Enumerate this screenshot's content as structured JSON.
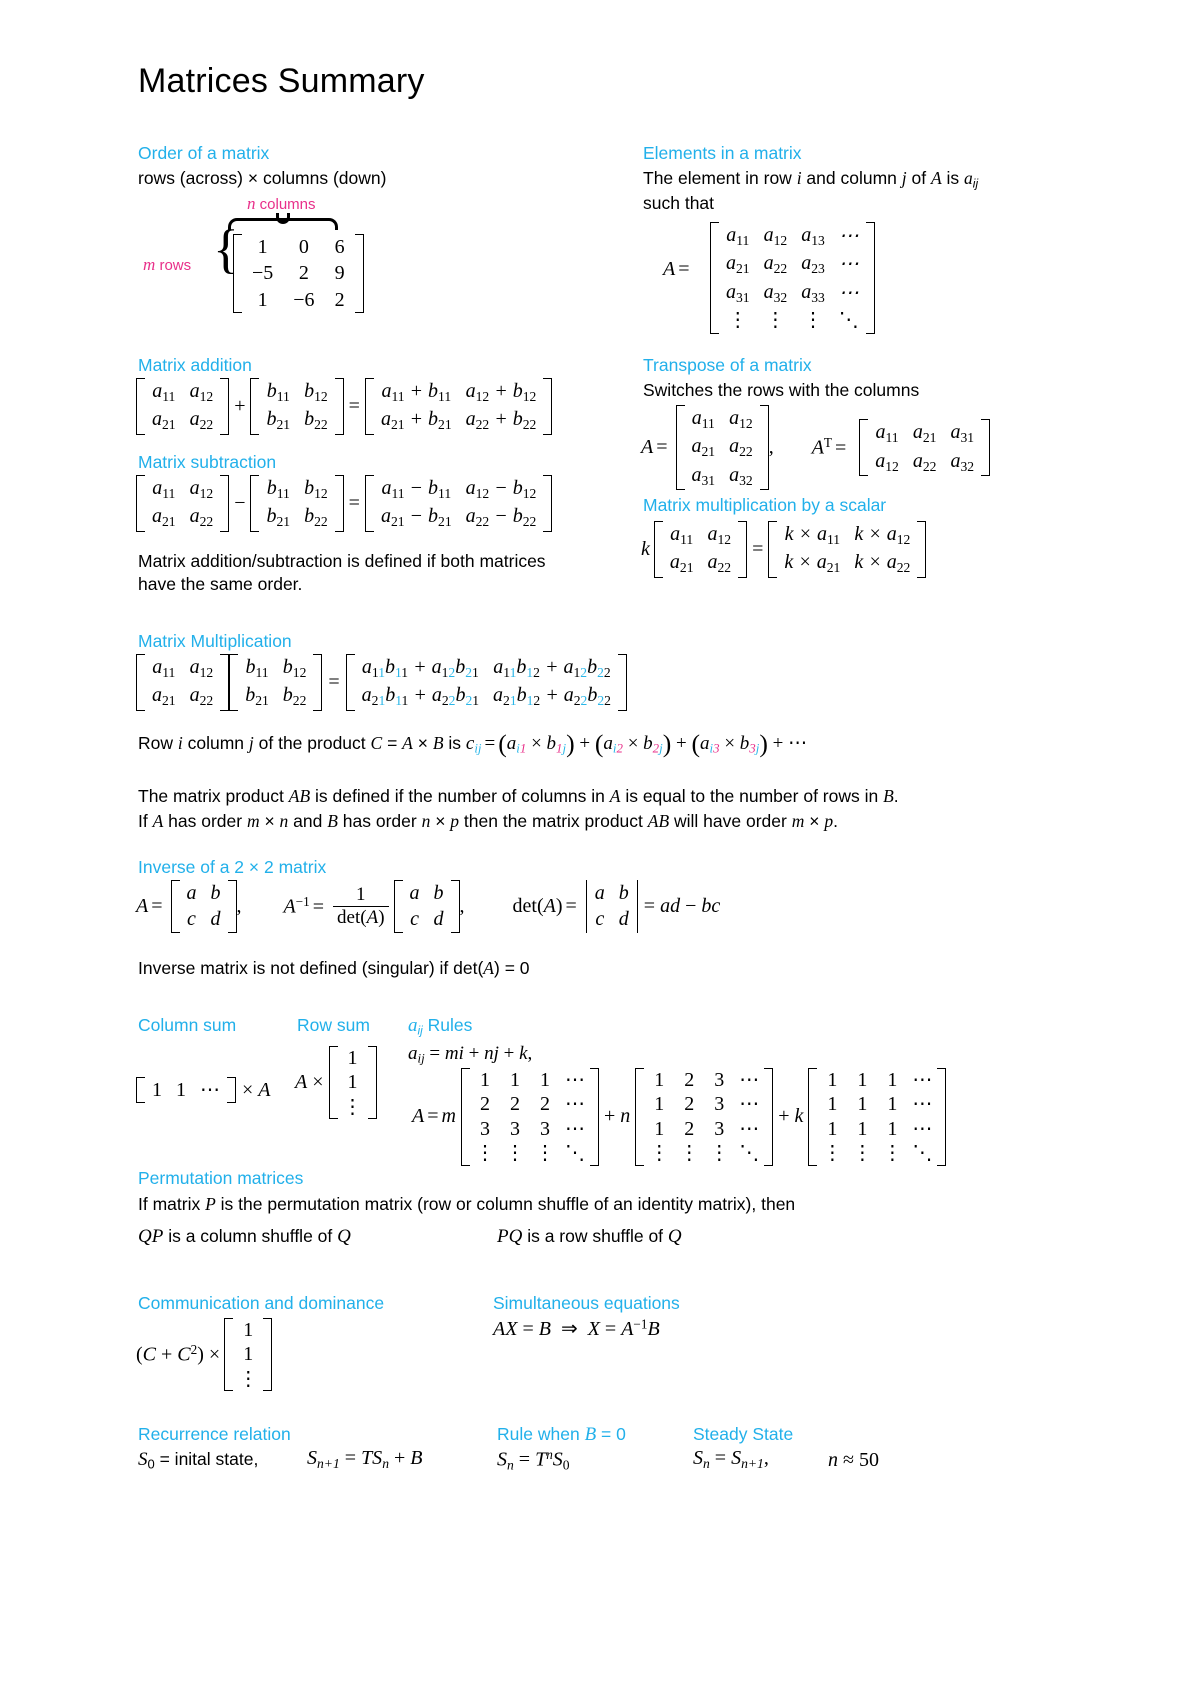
{
  "document": {
    "title": "Matrices Summary"
  },
  "colors": {
    "heading": "#22b0ea",
    "accent_cyan": "#29b6e8",
    "accent_magenta": "#e8308a",
    "text": "#000000",
    "background": "#ffffff"
  },
  "sections": {
    "order": {
      "heading": "Order of a matrix",
      "body": "rows (across) × columns (down)",
      "label_columns": "n columns",
      "label_rows": "m rows",
      "matrix": [
        [
          "1",
          "0",
          "6"
        ],
        [
          "−5",
          "2",
          "9"
        ],
        [
          "1",
          "−6",
          "2"
        ]
      ]
    },
    "elements": {
      "heading": "Elements in a matrix",
      "body_line1": "The element in row i and column j of A is a",
      "body_line1_sub": "ij",
      "body_line2": "such that",
      "lhs": "A =",
      "matrix": [
        [
          "a11",
          "a12",
          "a13",
          "⋯"
        ],
        [
          "a21",
          "a22",
          "a23",
          "⋯"
        ],
        [
          "a31",
          "a32",
          "a33",
          "⋯"
        ],
        [
          "⋮",
          "⋮",
          "⋮",
          "⋱"
        ]
      ]
    },
    "addition": {
      "heading": "Matrix addition",
      "operator": "+",
      "equals": "=",
      "a": [
        [
          "a11",
          "a12"
        ],
        [
          "a21",
          "a22"
        ]
      ],
      "b": [
        [
          "b11",
          "b12"
        ],
        [
          "b21",
          "b22"
        ]
      ],
      "result": [
        [
          "a11 + b11",
          "a12 + b12"
        ],
        [
          "a21 + b21",
          "a22 + b22"
        ]
      ]
    },
    "subtraction": {
      "heading": "Matrix subtraction",
      "operator": "−",
      "equals": "=",
      "a": [
        [
          "a11",
          "a12"
        ],
        [
          "a21",
          "a22"
        ]
      ],
      "b": [
        [
          "b11",
          "b12"
        ],
        [
          "b21",
          "b22"
        ]
      ],
      "result": [
        [
          "a11 − b11",
          "a12 − b12"
        ],
        [
          "a21 − b21",
          "a22 − b22"
        ]
      ],
      "note_line1": "Matrix addition/subtraction is defined if both matrices",
      "note_line2": "have the same order."
    },
    "transpose": {
      "heading": "Transpose of a matrix",
      "body": "Switches the rows with the columns",
      "lhs_a": "A =",
      "a": [
        [
          "a11",
          "a12"
        ],
        [
          "a21",
          "a22"
        ],
        [
          "a31",
          "a32"
        ]
      ],
      "comma": ",",
      "lhs_at": "A",
      "lhs_at_sup": "T",
      "lhs_at_eq": "=",
      "at": [
        [
          "a11",
          "a21",
          "a31"
        ],
        [
          "a12",
          "a22",
          "a32"
        ]
      ]
    },
    "scalar": {
      "heading": "Matrix multiplication by a scalar",
      "scalar_symbol": "k",
      "equals": "=",
      "a": [
        [
          "a11",
          "a12"
        ],
        [
          "a21",
          "a22"
        ]
      ],
      "result": [
        [
          "k × a11",
          "k × a12"
        ],
        [
          "k × a21",
          "k × a22"
        ]
      ]
    },
    "multiplication": {
      "heading": "Matrix Multiplication",
      "equals": "=",
      "a": [
        [
          "a11",
          "a12"
        ],
        [
          "a21",
          "a22"
        ]
      ],
      "b": [
        [
          "b11",
          "b12"
        ],
        [
          "b21",
          "b22"
        ]
      ],
      "result": [
        [
          "a11b11 + a12b21",
          "a11b12 + a12b22"
        ],
        [
          "a21b11 + a22b21",
          "a21b12 + a22b22"
        ]
      ],
      "rule_text_pre": "Row i column j of the product C = A × B is c",
      "rule_formula": "cij = (ai1 × b1j) + (ai2 × b2j) + (ai3 × b3j) + ⋯",
      "defined_line1": "The matrix product AB is defined if the number of columns in A is equal to the number of rows in B.",
      "defined_line2": "If A has order m × n and B has order n × p then the matrix product AB will have order m × p."
    },
    "inverse": {
      "heading": "Inverse of a 2 × 2 matrix",
      "a_label": "A =",
      "a": [
        [
          "a",
          "b"
        ],
        [
          "c",
          "d"
        ]
      ],
      "comma": ",",
      "ainv_label": "A",
      "ainv_sup": "−1",
      "ainv_eq": "=",
      "frac_num": "1",
      "frac_den": "det(A)",
      "adj": [
        [
          "a",
          "b"
        ],
        [
          "c",
          "d"
        ]
      ],
      "det_label": "det(A) =",
      "det_matrix": [
        [
          "a",
          "b"
        ],
        [
          "c",
          "d"
        ]
      ],
      "det_value": "= ad − bc",
      "singular_note": "Inverse matrix is not defined (singular) if det(A) = 0"
    },
    "column_sum": {
      "heading": "Column sum",
      "formula_row": [
        "1",
        "1",
        "⋯"
      ],
      "formula_tail": "× A"
    },
    "row_sum": {
      "heading": "Row sum",
      "formula_head": "A ×",
      "vector": [
        "1",
        "1",
        "⋮"
      ]
    },
    "aij_rules": {
      "heading": "aᵢⱼ Rules",
      "heading_base": "a",
      "heading_sub": "ij",
      "heading_tail": " Rules",
      "formula": "aij = mi + nj + k,",
      "lhs": "A = m",
      "m_matrix": [
        [
          "1",
          "1",
          "1",
          "⋯"
        ],
        [
          "2",
          "2",
          "2",
          "⋯"
        ],
        [
          "3",
          "3",
          "3",
          "⋯"
        ],
        [
          "⋮",
          "⋮",
          "⋮",
          "⋱"
        ]
      ],
      "plus_n": "+ n",
      "n_matrix": [
        [
          "1",
          "2",
          "3",
          "⋯"
        ],
        [
          "1",
          "2",
          "3",
          "⋯"
        ],
        [
          "1",
          "2",
          "3",
          "⋯"
        ],
        [
          "⋮",
          "⋮",
          "⋮",
          "⋱"
        ]
      ],
      "plus_k": "+ k",
      "k_matrix": [
        [
          "1",
          "1",
          "1",
          "⋯"
        ],
        [
          "1",
          "1",
          "1",
          "⋯"
        ],
        [
          "1",
          "1",
          "1",
          "⋯"
        ],
        [
          "⋮",
          "⋮",
          "⋮",
          "⋱"
        ]
      ]
    },
    "permutation": {
      "heading": "Permutation matrices",
      "body": "If matrix P is the permutation matrix (row or column shuffle of an identity matrix), then",
      "left": "QP is a column shuffle of Q",
      "right": "PQ is a row shuffle of Q"
    },
    "communication": {
      "heading": "Communication and dominance",
      "formula": "(C + C²) ×",
      "vector": [
        "1",
        "1",
        "⋮"
      ]
    },
    "simultaneous": {
      "heading": "Simultaneous equations",
      "formula": "AX = B  ⇒  X = A⁻¹B"
    },
    "recurrence": {
      "heading": "Recurrence relation",
      "initial": "S₀ = inital state,",
      "formula": "Sₙ₊₁ = TSₙ + B"
    },
    "rule_b_zero": {
      "heading": "Rule when B = 0",
      "formula": "Sₙ = TⁿS₀"
    },
    "steady_state": {
      "heading": "Steady State",
      "formula": "Sₙ = Sₙ₊₁,",
      "approx": "n ≈ 50"
    }
  }
}
